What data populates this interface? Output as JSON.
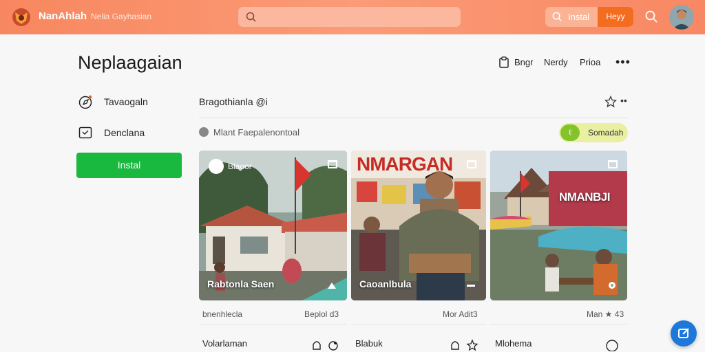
{
  "app": {
    "brand": "NanAhlah",
    "brand_sub": "Nelia Gayhasian",
    "install_label": "Instal",
    "happy_label": "Heyy"
  },
  "header": {
    "title": "Neplaagaian",
    "links": [
      "Bngr",
      "Nerdy",
      "Prioa"
    ]
  },
  "sidebar": {
    "items": [
      {
        "label": "Tavaogaln",
        "icon": "compass-icon"
      },
      {
        "label": "Denclana",
        "icon": "inbox-icon"
      }
    ],
    "install_button": "Instal"
  },
  "section": {
    "title": "Bragothianla @i",
    "subtitle": "Mlant Faepalenontoal",
    "toggle_label": "Somadah"
  },
  "cards": [
    {
      "chip": "Blaoor",
      "caption": "Rabtonla Saen",
      "meta_left": "bnenhlecla",
      "meta_right": "Beplol d3",
      "footer": "Volarlaman"
    },
    {
      "chip": "",
      "caption": "Caoanlbula",
      "meta_left": "",
      "meta_right": "Mor Adit3",
      "footer": "Blabuk",
      "banner": "NMARGAN"
    },
    {
      "chip": "",
      "caption": "",
      "meta_left": "",
      "meta_right": "Man ★ 43",
      "footer": "Mlohema",
      "banner": "NMANBJI"
    }
  ],
  "colors": {
    "topbar": "#f88863",
    "accent_orange": "#f46c20",
    "install_green": "#19b83f",
    "toggle_bg": "#e9f0a2",
    "fab_blue": "#1e78d9"
  }
}
